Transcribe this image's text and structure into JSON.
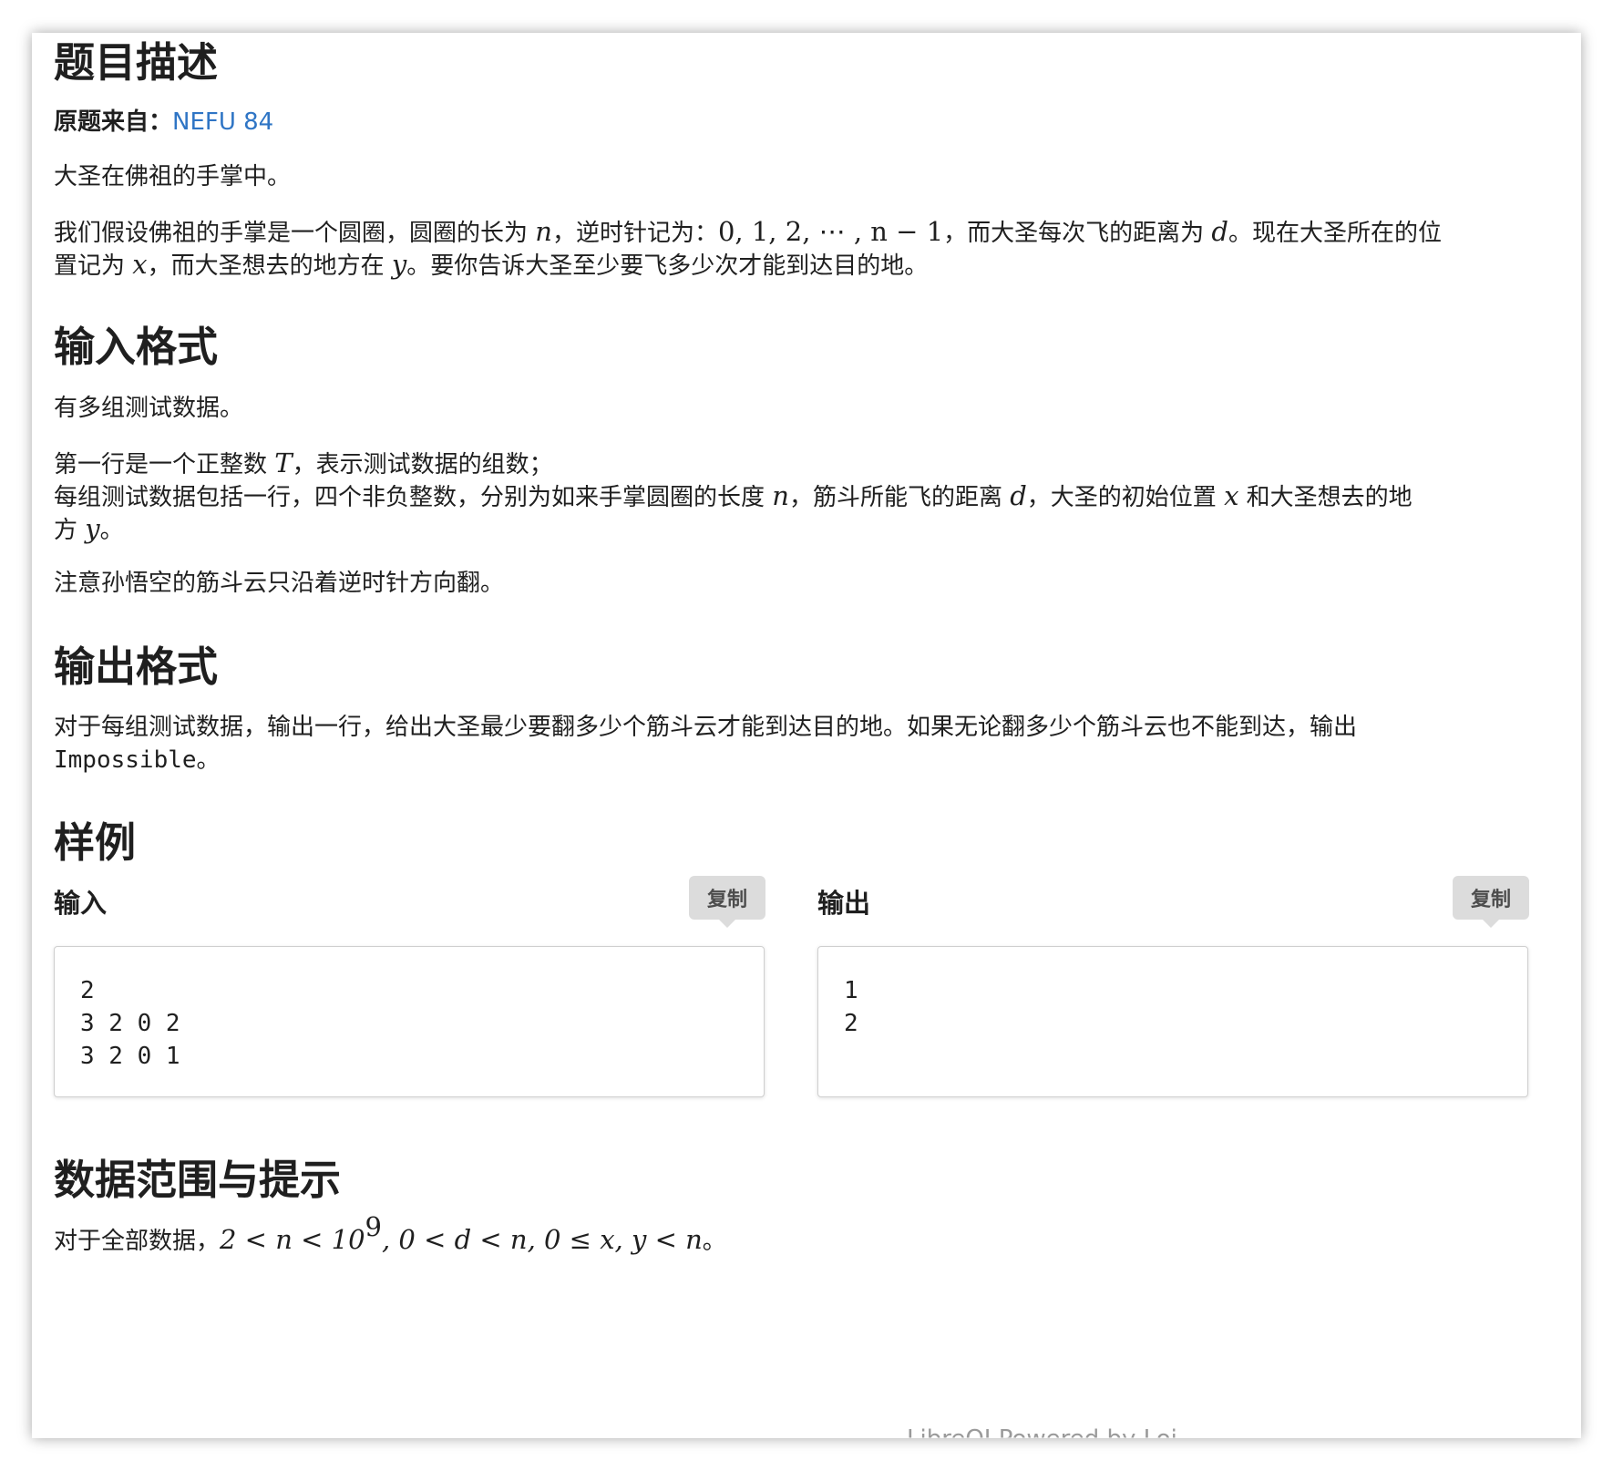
{
  "description": {
    "title": "题目描述",
    "source_label": "原题来自：",
    "source_link": "NEFU 84",
    "para1": "大圣在佛祖的手掌中。",
    "para2_line1": {
      "t1": "我们假设佛祖的手掌是一个圆圈，圆圈的长为 ",
      "m1": "n",
      "t2": "，逆时针记为：",
      "m2": "0, 1, 2, ⋯ , n − 1",
      "t3": "，而大圣每次飞的距离为 ",
      "m3": "d",
      "t4": "。现在大圣所在的位"
    },
    "para2_line2": {
      "t1": "置记为 ",
      "m1": "x",
      "t2": "，而大圣想去的地方在 ",
      "m2": "y",
      "t3": "。要你告诉大圣至少要飞多少次才能到达目的地。"
    }
  },
  "input_format": {
    "title": "输入格式",
    "para1": "有多组测试数据。",
    "line1": {
      "t1": "第一行是一个正整数 ",
      "m1": "T",
      "t2": "，表示测试数据的组数；"
    },
    "line2": {
      "t1": "每组测试数据包括一行，四个非负整数，分别为如来手掌圆圈的长度 ",
      "m1": "n",
      "t2": "，筋斗所能飞的距离 ",
      "m2": "d",
      "t3": "，大圣的初始位置 ",
      "m3": "x",
      "t4": " 和大圣想去的地"
    },
    "line3": {
      "t1": "方 ",
      "m1": "y",
      "t2": "。"
    },
    "note": "注意孙悟空的筋斗云只沿着逆时针方向翻。"
  },
  "output_format": {
    "title": "输出格式",
    "line1": "对于每组测试数据，输出一行，给出大圣最少要翻多少个筋斗云才能到达目的地。如果无论翻多少个筋斗云也不能到达，输出",
    "impossible": "Impossible",
    "period": "。"
  },
  "samples": {
    "title": "样例",
    "input_label": "输入",
    "output_label": "输出",
    "copy_label": "复制",
    "input_text": "2\n3 2 0 2\n3 2 0 1",
    "output_text": "1\n2"
  },
  "range": {
    "title": "数据范围与提示",
    "t1": "对于全部数据，",
    "m1": "2 < n < 10",
    "exp": "9",
    "m2": ", 0 < d < n, 0 ≤ x, y < n",
    "t2": "。"
  },
  "footer": {
    "text": "LibreOJ Powered by Loj"
  }
}
